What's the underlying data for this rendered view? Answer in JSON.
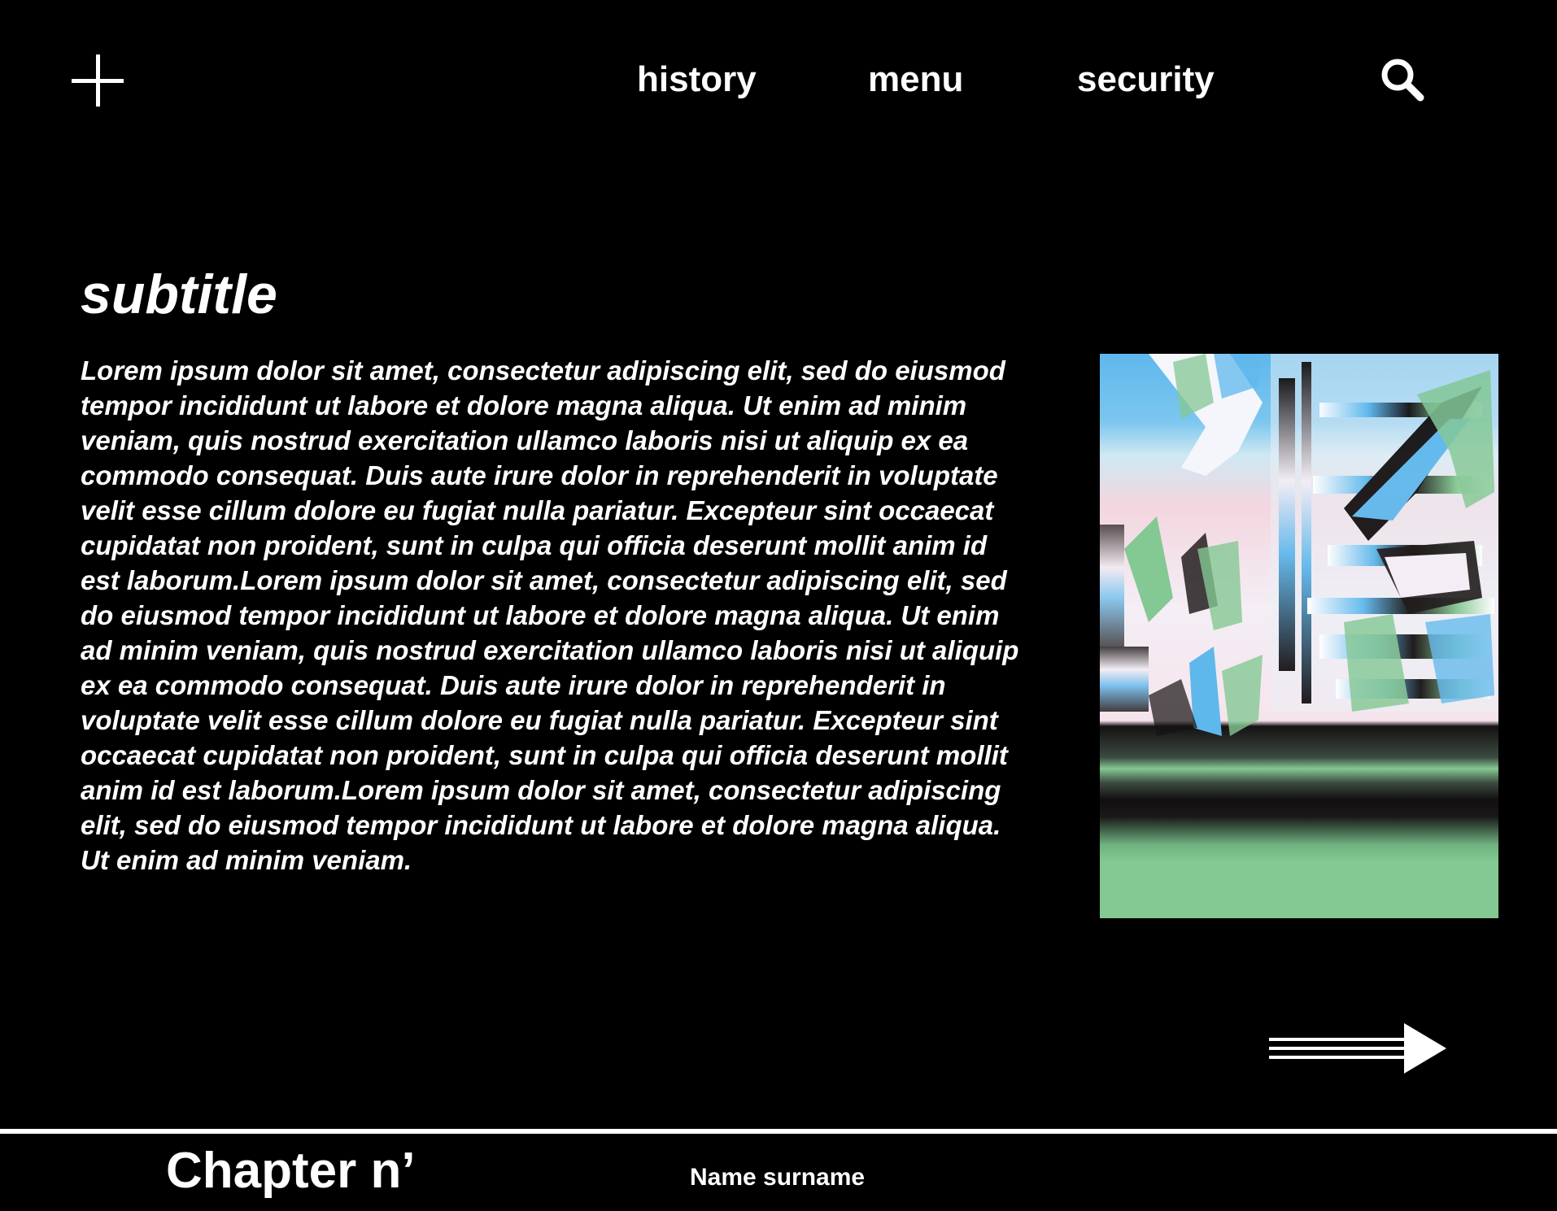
{
  "header": {
    "add_icon": "plus-icon",
    "nav": [
      {
        "label": "history"
      },
      {
        "label": "menu"
      },
      {
        "label": "security"
      }
    ],
    "search_icon": "search-icon"
  },
  "main": {
    "subtitle": "subtitle",
    "body": "Lorem ipsum dolor sit amet, consectetur adipiscing elit, sed do eiusmod tempor incididunt ut labore et dolore magna aliqua. Ut enim ad minim veniam, quis nostrud exercitation ullamco laboris nisi ut aliquip ex ea commodo consequat. Duis aute irure dolor in reprehenderit in voluptate velit esse cillum dolore eu fugiat nulla pariatur. Excepteur sint occaecat cupidatat non proident, sunt in culpa qui officia deserunt mollit anim id est laborum.Lorem ipsum dolor sit amet, consectetur adipiscing elit, sed do eiusmod tempor incididunt ut labore et dolore magna aliqua. Ut enim ad minim veniam, quis nostrud exercitation ullamco laboris nisi ut aliquip ex ea commodo consequat. Duis aute irure dolor in reprehenderit in voluptate velit esse cillum dolore eu fugiat nulla pariatur. Excepteur sint occaecat cupidatat non proident, sunt in culpa qui officia deserunt mollit anim id est laborum.Lorem ipsum dolor sit amet, consectetur adipiscing elit, sed do eiusmod tempor incididunt ut labore et dolore magna aliqua. Ut enim ad minim veniam.",
    "next_icon": "arrow-right-icon"
  },
  "footer": {
    "chapter": "Chapter n’",
    "author": "Name surname"
  },
  "colors": {
    "background": "#000000",
    "text": "#ffffff",
    "art_sky_blue": "#5fb8ec",
    "art_pink": "#f3dce6",
    "art_green": "#84c893",
    "art_dark": "#161212"
  }
}
